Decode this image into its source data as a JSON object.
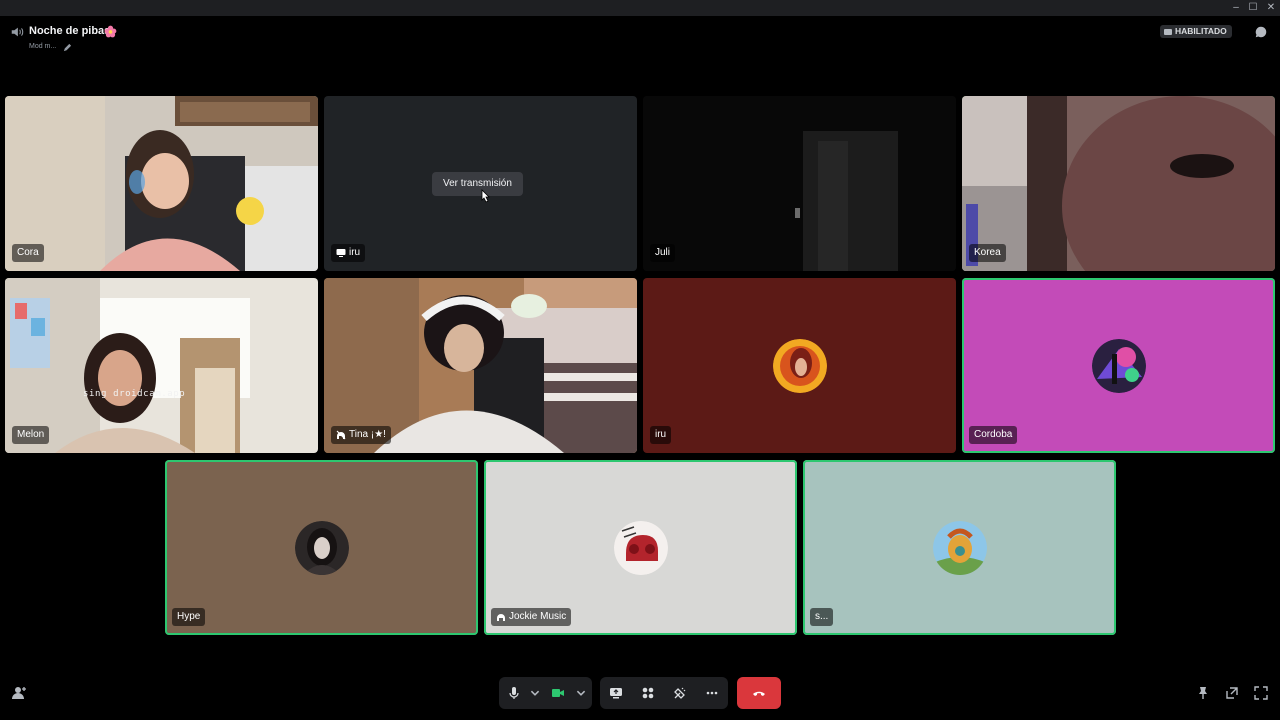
{
  "window": {
    "minimize": "–",
    "maximize": "☐",
    "close": "✕"
  },
  "header": {
    "channel_name": "Noche de pibas",
    "status": "Mod m...",
    "activity_badge": "HABILITADO"
  },
  "tiles": [
    {
      "name": "Cora",
      "type": "video",
      "speaking": false
    },
    {
      "name": "iru",
      "type": "stream",
      "speaking": false,
      "stream_button": "Ver transmisión"
    },
    {
      "name": "Juli",
      "type": "video",
      "speaking": false
    },
    {
      "name": "Korea",
      "type": "video",
      "speaking": true
    },
    {
      "name": "Melon",
      "type": "video",
      "speaking": false,
      "overlay_text": "sing droidcam.app"
    },
    {
      "name": "Tina ¡★!",
      "type": "video",
      "speaking": false
    },
    {
      "name": "iru",
      "type": "avatar",
      "speaking": false,
      "background": "#5c1a16"
    },
    {
      "name": "Cordoba",
      "type": "avatar",
      "speaking": true,
      "background": "#c34bb8"
    },
    {
      "name": "Hype",
      "type": "avatar",
      "speaking": true,
      "background": "#7b634f"
    },
    {
      "name": "Jockie Music",
      "type": "avatar",
      "speaking": true,
      "background": "#d8d8d6",
      "bot": true
    },
    {
      "name": "s...",
      "type": "avatar",
      "speaking": true,
      "background": "#a7c3be"
    }
  ],
  "controls": {
    "mic": "microphone-icon",
    "camera": "camera-icon",
    "screen_share": "screen-share-icon",
    "activities": "activities-icon",
    "soundboard": "soundboard-icon",
    "more": "more-icon",
    "disconnect": "hang-up-icon"
  },
  "colors": {
    "speaking": "#2dc770",
    "disconnect": "#da373c",
    "camera_on": "#2dc770"
  }
}
